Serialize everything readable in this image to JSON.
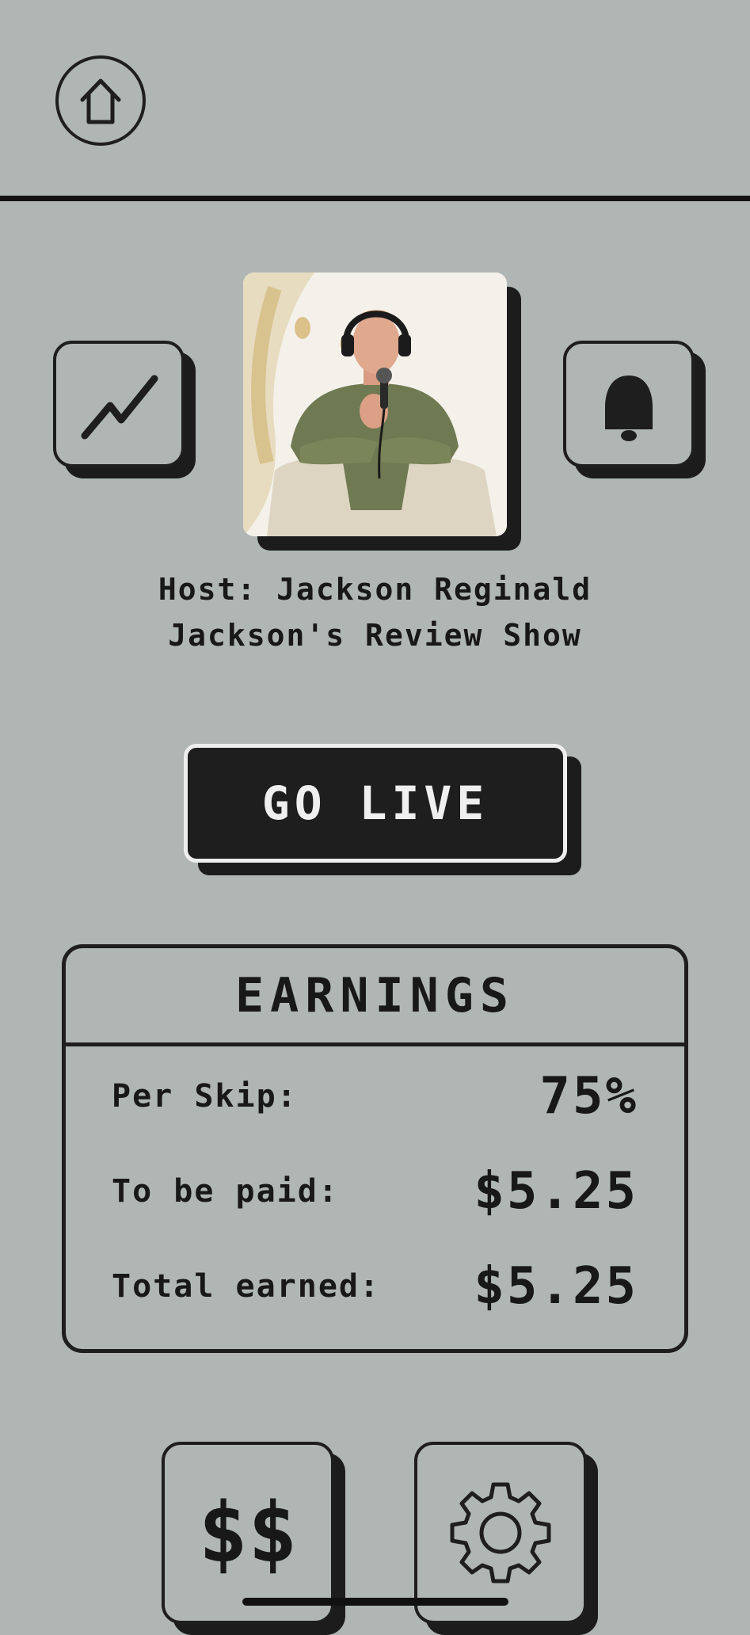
{
  "nav": {
    "home_icon": "home-icon"
  },
  "profile": {
    "photo_description_icon": "host-photo",
    "host_label": "Host: Jackson Reginald",
    "show_title": "Jackson's Review Show"
  },
  "actions": {
    "stats_icon": "trend-chart-icon",
    "notifications_icon": "bell-icon",
    "go_live_label": "GO LIVE"
  },
  "earnings": {
    "title": "EARNINGS",
    "rows": [
      {
        "label": "Per Skip:",
        "value": "75%"
      },
      {
        "label": "To be paid:",
        "value": "$5.25"
      },
      {
        "label": "Total earned:",
        "value": "$5.25"
      }
    ]
  },
  "bottom_nav": {
    "money_label": "$$",
    "settings_icon": "gear-icon"
  },
  "colors": {
    "background": "#b0b6b3",
    "ink": "#1e1e1e",
    "button_text": "#efefef"
  }
}
